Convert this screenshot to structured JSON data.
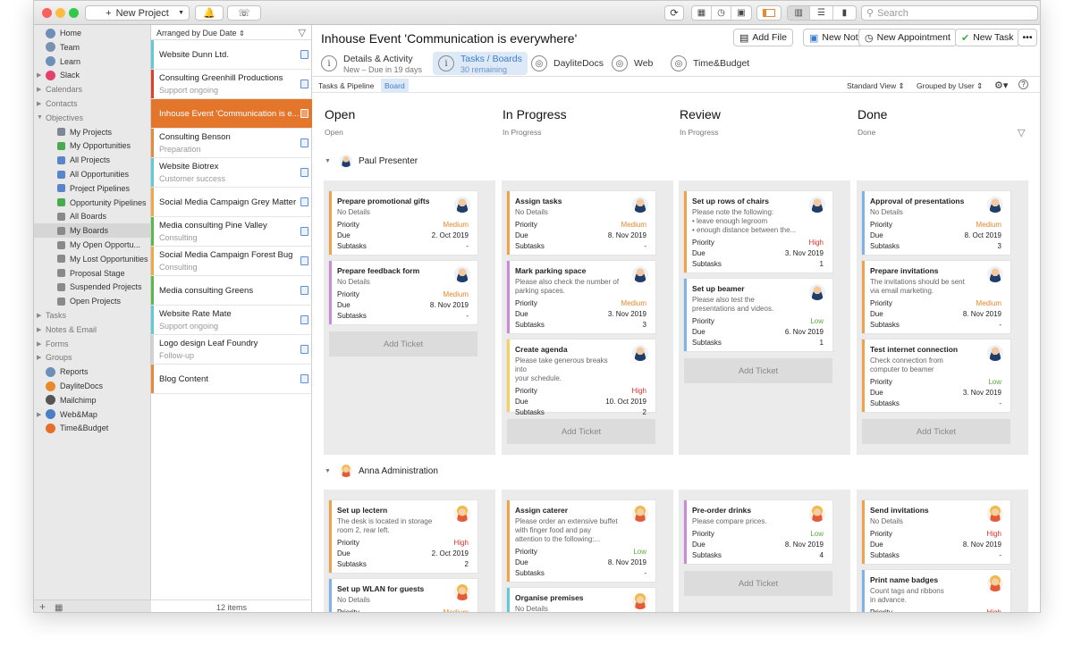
{
  "toolbar": {
    "new_project": "New Project",
    "search_placeholder": "Search"
  },
  "sidebar": {
    "items": [
      {
        "label": "Home",
        "color": "#6d8fb8",
        "level": 0
      },
      {
        "label": "Team",
        "color": "#7a92b0",
        "level": 0
      },
      {
        "label": "Learn",
        "color": "#6d8fb8",
        "level": 0
      },
      {
        "label": "Slack",
        "color": "#e1416b",
        "level": 0,
        "tri": "▶"
      },
      {
        "label": "Calendars",
        "level": 0,
        "tri": "▶",
        "group": true
      },
      {
        "label": "Contacts",
        "level": 0,
        "tri": "▶",
        "group": true
      },
      {
        "label": "Objectives",
        "level": 0,
        "tri": "▼",
        "group": true
      },
      {
        "label": "My Projects",
        "color": "#7e8794",
        "level": 1
      },
      {
        "label": "My Opportunities",
        "color": "#4aaa52",
        "level": 1
      },
      {
        "label": "All Projects",
        "color": "#5a86c9",
        "level": 1
      },
      {
        "label": "All Opportunities",
        "color": "#5a86c9",
        "level": 1
      },
      {
        "label": "Project Pipelines",
        "color": "#5a86c9",
        "level": 1
      },
      {
        "label": "Opportunity Pipelines",
        "color": "#4aaa52",
        "level": 1
      },
      {
        "label": "All Boards",
        "color": "#8a8a8a",
        "level": 1
      },
      {
        "label": "My Boards",
        "color": "#8a8a8a",
        "level": 1,
        "sel": true
      },
      {
        "label": "My Open Opportu...",
        "color": "#8a8a8a",
        "level": 1
      },
      {
        "label": "My Lost Opportunities",
        "color": "#8a8a8a",
        "level": 1
      },
      {
        "label": "Proposal Stage",
        "color": "#8a8a8a",
        "level": 1
      },
      {
        "label": "Suspended Projects",
        "color": "#8a8a8a",
        "level": 1
      },
      {
        "label": "Open Projects",
        "color": "#8a8a8a",
        "level": 1
      },
      {
        "label": "Tasks",
        "level": 0,
        "tri": "▶",
        "group": true
      },
      {
        "label": "Notes & Email",
        "level": 0,
        "tri": "▶",
        "group": true
      },
      {
        "label": "Forms",
        "level": 0,
        "tri": "▶",
        "group": true
      },
      {
        "label": "Groups",
        "level": 0,
        "tri": "▶",
        "group": true
      },
      {
        "label": "Reports",
        "color": "#6d8fb8",
        "level": 0
      },
      {
        "label": "DayliteDocs",
        "color": "#e88a2b",
        "level": 0
      },
      {
        "label": "Mailchimp",
        "color": "#555",
        "level": 0
      },
      {
        "label": "Web&Map",
        "color": "#4a7fc4",
        "level": 0,
        "tri": "▶"
      },
      {
        "label": "Time&Budget",
        "color": "#e46f2a",
        "level": 0
      }
    ]
  },
  "list": {
    "header": "Arranged by Due Date",
    "footer": "12 items",
    "items": [
      {
        "title": "Website Dunn Ltd.",
        "sub": "",
        "color": "#62c9d6",
        "h": 33
      },
      {
        "title": "Consulting Greenhill Productions",
        "sub": "Support ongoing",
        "color": "#d8432b",
        "h": 33
      },
      {
        "title": "Inhouse Event 'Communication is e...",
        "sub": "",
        "color": "#e4762c",
        "h": 33,
        "sel": true
      },
      {
        "title": "Consulting Benson",
        "sub": "Preparation",
        "color": "#e8893a",
        "h": 33
      },
      {
        "title": "Website Biotrex",
        "sub": "Customer success",
        "color": "#62c9d6",
        "h": 33
      },
      {
        "title": "Social Media Campaign Grey Matter",
        "sub": "",
        "color": "#f0a84a",
        "h": 33
      },
      {
        "title": "Media consulting Pine Valley",
        "sub": "Consulting",
        "color": "#5bb84a",
        "h": 33
      },
      {
        "title": "Social Media Campaign Forest Bug",
        "sub": "Consulting",
        "color": "#f0a84a",
        "h": 33
      },
      {
        "title": "Media consulting Greens",
        "sub": "",
        "color": "#5bb84a",
        "h": 33
      },
      {
        "title": "Website Rate Mate",
        "sub": "Support ongoing",
        "color": "#62c9d6",
        "h": 33
      },
      {
        "title": "Logo design Leaf Foundry",
        "sub": "Follow-up",
        "color": "#d1d1d1",
        "h": 33
      },
      {
        "title": "Blog Content",
        "sub": "",
        "color": "#e8893a",
        "h": 33
      }
    ]
  },
  "main": {
    "title": "Inhouse Event 'Communication is everywhere'",
    "actions": [
      "Add File",
      "New Note",
      "New Appointment",
      "New Task"
    ],
    "tabs": [
      {
        "label": "Details & Activity",
        "sub": "New – Due in 19 days",
        "icon": "i"
      },
      {
        "label": "Tasks / Boards",
        "sub": "30 remaining",
        "icon": "i",
        "active": true
      },
      {
        "label": "DayliteDocs",
        "sub": "",
        "icon": ""
      },
      {
        "label": "Web",
        "sub": "",
        "icon": ""
      },
      {
        "label": "Time&Budget",
        "sub": "",
        "icon": ""
      }
    ],
    "subbar": {
      "left": "Tasks & Pipeline",
      "active": "Board",
      "view": "Standard View",
      "grouped": "Grouped by User"
    }
  },
  "board": {
    "columns": [
      {
        "name": "Open",
        "sub": "Open"
      },
      {
        "name": "In Progress",
        "sub": "In Progress"
      },
      {
        "name": "Review",
        "sub": "In Progress"
      },
      {
        "name": "Done",
        "sub": "Done"
      }
    ],
    "labels": {
      "priority": "Priority",
      "due": "Due",
      "subtasks": "Subtasks",
      "add": "Add Ticket"
    },
    "groups": [
      {
        "user": "Paul Presenter",
        "avatar": "m",
        "lanes": [
          [
            {
              "t": "Prepare promotional gifts",
              "d": "No Details",
              "p": "Medium",
              "due": "2. Oct 2019",
              "s": "-",
              "c": "#f0a24a"
            },
            {
              "t": "Prepare feedback form",
              "d": "No Details",
              "p": "Medium",
              "due": "8. Nov 2019",
              "s": "-",
              "c": "#c98ad6"
            }
          ],
          [
            {
              "t": "Assign tasks",
              "d": "No Details",
              "p": "Medium",
              "due": "8. Nov 2019",
              "s": "-",
              "c": "#f0a24a"
            },
            {
              "t": "Mark parking space",
              "d": "Please also check the number of\nparking spaces.",
              "p": "Medium",
              "due": "3. Nov 2019",
              "s": "3",
              "c": "#c98ad6"
            },
            {
              "t": "Create agenda",
              "d": "Please take generous breaks into\nyour schedule.",
              "p": "High",
              "due": "10. Oct 2019",
              "s": "2",
              "c": "#f3d25a"
            }
          ],
          [
            {
              "t": "Set up rows of chairs",
              "d": "Please note the following:\n• leave enough legroom\n• enough distance between the...",
              "p": "High",
              "due": "3. Nov 2019",
              "s": "1",
              "c": "#f0a24a"
            },
            {
              "t": "Set up beamer",
              "d": "Please also test the\npresentations and videos.",
              "p": "Low",
              "due": "6. Nov 2019",
              "s": "1",
              "c": "#7fb2e6"
            }
          ],
          [
            {
              "t": "Approval of presentations",
              "d": "No Details",
              "p": "Medium",
              "due": "8. Oct 2019",
              "s": "3",
              "c": "#7fb2e6"
            },
            {
              "t": "Prepare invitations",
              "d": "The invitations should be sent\nvia email marketing.",
              "p": "Medium",
              "due": "8. Nov 2019",
              "s": "-",
              "c": "#f0a24a"
            },
            {
              "t": "Test internet connection",
              "d": "Check connection from\ncomputer to beamer",
              "p": "Low",
              "due": "3. Nov 2019",
              "s": "-",
              "c": "#f0a24a"
            }
          ]
        ]
      },
      {
        "user": "Anna Administration",
        "avatar": "f",
        "lanes": [
          [
            {
              "t": "Set up lectern",
              "d": "The desk is located in storage\nroom 2, rear left.",
              "p": "High",
              "due": "2. Oct 2019",
              "s": "2",
              "c": "#f0a24a"
            },
            {
              "t": "Set up WLAN for guests",
              "d": "No Details",
              "p": "Medium",
              "due": "",
              "s": "",
              "c": "#7fb2e6"
            }
          ],
          [
            {
              "t": "Assign caterer",
              "d": "Please order an extensive buffet\nwith finger food and pay\nattention to the following:...",
              "p": "Low",
              "due": "8. Nov 2019",
              "s": "-",
              "c": "#f0a24a"
            },
            {
              "t": "Organise premises",
              "d": "No Details",
              "p": "",
              "due": "",
              "s": "",
              "c": "#62c9d6"
            }
          ],
          [
            {
              "t": "Pre-order drinks",
              "d": "Please compare prices.",
              "p": "Low",
              "due": "8. Nov 2019",
              "s": "4",
              "c": "#c98ad6"
            }
          ],
          [
            {
              "t": "Send invitations",
              "d": "No Details",
              "p": "High",
              "due": "8. Nov 2019",
              "s": "-",
              "c": "#f0a24a"
            },
            {
              "t": "Print name badges",
              "d": "Count tags and ribbons\nin advance.",
              "p": "High",
              "due": "",
              "s": "",
              "c": "#7fb2e6"
            }
          ]
        ]
      }
    ]
  }
}
